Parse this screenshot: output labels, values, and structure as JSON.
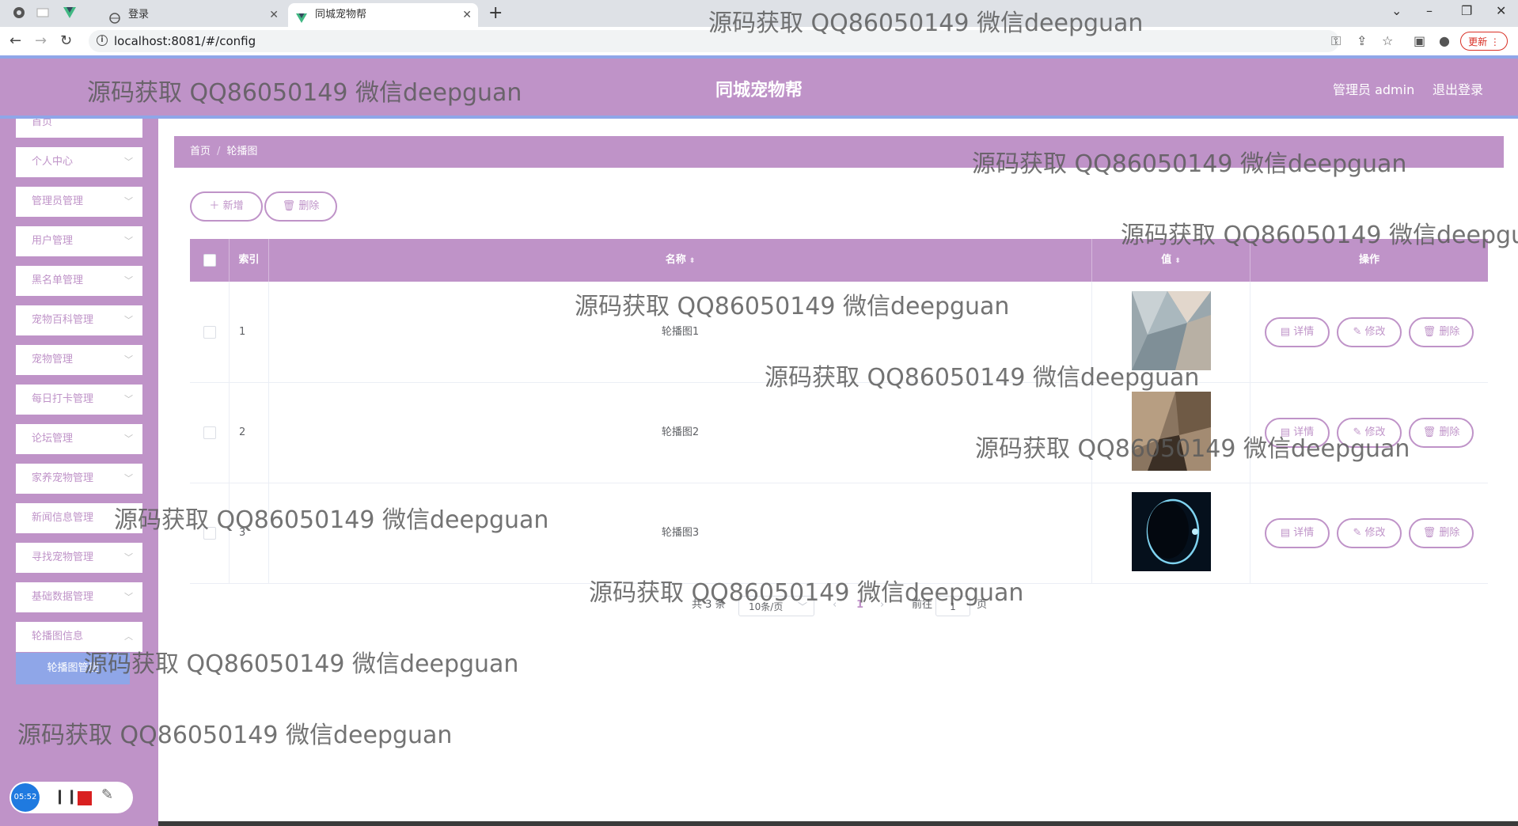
{
  "browser": {
    "tabs": [
      {
        "label": "登录",
        "active": false
      },
      {
        "label": "同城宠物帮",
        "active": true
      }
    ],
    "url": "localhost:8081/#/config",
    "update_label": "更新"
  },
  "header": {
    "title": "同城宠物帮",
    "user": "管理员 admin",
    "logout": "退出登录"
  },
  "sidebar": {
    "items": [
      {
        "label": "首页"
      },
      {
        "label": "个人中心"
      },
      {
        "label": "管理员管理"
      },
      {
        "label": "用户管理"
      },
      {
        "label": "黑名单管理"
      },
      {
        "label": "宠物百科管理"
      },
      {
        "label": "宠物管理"
      },
      {
        "label": "每日打卡管理"
      },
      {
        "label": "论坛管理"
      },
      {
        "label": "家养宠物管理"
      },
      {
        "label": "新闻信息管理"
      },
      {
        "label": "寻找宠物管理"
      },
      {
        "label": "基础数据管理"
      },
      {
        "label": "轮播图信息"
      }
    ],
    "submenu": {
      "label": "轮播图管理"
    },
    "recorder": {
      "timer": "05:52"
    }
  },
  "breadcrumb": {
    "home": "首页",
    "current": "轮播图"
  },
  "toolbar": {
    "add_label": "新增",
    "delete_label": "删除"
  },
  "table": {
    "columns": {
      "index": "索引",
      "name": "名称",
      "value": "值",
      "actions": "操作"
    },
    "rows": [
      {
        "index": "1",
        "name": "轮播图1"
      },
      {
        "index": "2",
        "name": "轮播图2"
      },
      {
        "index": "3",
        "name": "轮播图3"
      }
    ],
    "actions": {
      "detail": "详情",
      "edit": "修改",
      "delete": "删除"
    }
  },
  "pagination": {
    "total": "共 3 条",
    "page_size": "10条/页",
    "current_page": "1",
    "goto_label": "前往",
    "goto_value": "1",
    "page_suffix": "页"
  },
  "watermark": "源码获取 QQ86050149 微信deepguan",
  "colors": {
    "theme": "#bf93c8",
    "accent": "#8fa6e8"
  }
}
